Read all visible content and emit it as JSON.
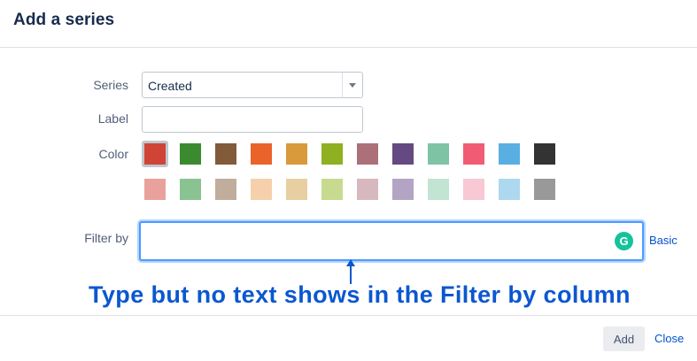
{
  "dialog": {
    "title": "Add a series"
  },
  "form": {
    "series_label": "Series",
    "series_value": "Created",
    "label_label": "Label",
    "label_value": "",
    "color_label": "Color",
    "filter_label": "Filter by",
    "filter_value": "",
    "basic_link": "Basic",
    "grammarly_icon": "G"
  },
  "colors": {
    "selected_index": 0,
    "row1": [
      "#d04437",
      "#3b8a2f",
      "#815b3a",
      "#ea632b",
      "#d89a3b",
      "#8eb021",
      "#ac707a",
      "#654982",
      "#7ec4a4",
      "#f15c75",
      "#59afe1",
      "#333333"
    ],
    "row2": [
      "#e8a29b",
      "#8ac392",
      "#c0ad9c",
      "#f6d0ad",
      "#e8cfa1",
      "#c8da8f",
      "#d7b8be",
      "#b3a4c4",
      "#c2e4d3",
      "#f8c8d5",
      "#acd8f0",
      "#999999"
    ]
  },
  "annotation": {
    "text": "Type but no text shows in the Filter by column",
    "color": "#0b57d0"
  },
  "footer": {
    "add_label": "Add",
    "close_label": "Close"
  },
  "theme": {
    "accent": "#0052cc",
    "focus": "#4c9aff"
  }
}
